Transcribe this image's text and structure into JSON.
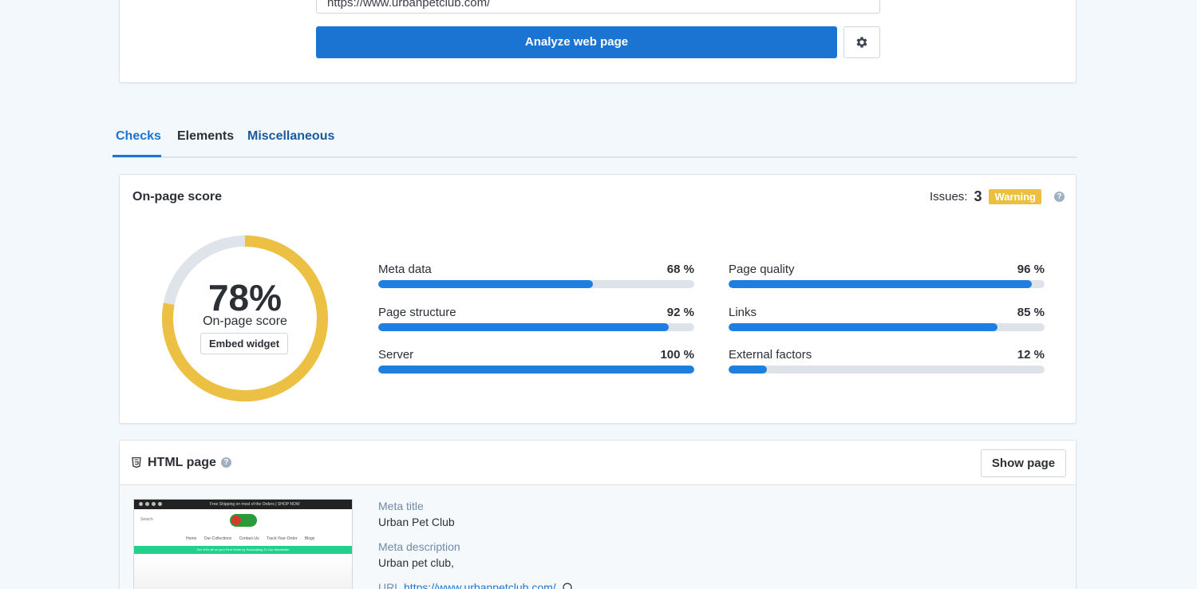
{
  "top": {
    "url_value": "https://www.urbanpetclub.com/",
    "analyze_label": "Analyze web page"
  },
  "tabs": [
    {
      "label": "Checks",
      "active": true
    },
    {
      "label": "Elements",
      "active": false
    },
    {
      "label": "Miscellaneous",
      "active": false
    }
  ],
  "score_card": {
    "title": "On-page score",
    "issues_label": "Issues:",
    "issues_count": "3",
    "issues_badge": "Warning",
    "score": 78,
    "score_text": "78%",
    "score_label": "On-page score",
    "embed_label": "Embed widget",
    "metrics": [
      {
        "name": "Meta data",
        "value": 68,
        "value_text": "68 %"
      },
      {
        "name": "Page quality",
        "value": 96,
        "value_text": "96 %"
      },
      {
        "name": "Page structure",
        "value": 92,
        "value_text": "92 %"
      },
      {
        "name": "Links",
        "value": 85,
        "value_text": "85 %"
      },
      {
        "name": "Server",
        "value": 100,
        "value_text": "100 %"
      },
      {
        "name": "External factors",
        "value": 12,
        "value_text": "12 %"
      }
    ]
  },
  "html_page": {
    "title": "HTML page",
    "show_page_label": "Show page",
    "meta_title_label": "Meta title",
    "meta_title_value": "Urban Pet Club",
    "meta_description_label": "Meta description",
    "meta_description_value": "Urban pet club,",
    "url_label": "URL",
    "url_value": "https://www.urbanpetclub.com/",
    "thumbnail": {
      "topbar_text": "Free Shipping on most of the Orders | SHOP NOW",
      "search_text": "Search",
      "nav_text": "Home Our-Collections Contact-Us Track-Your-Order Blogs",
      "banner_text": "Get 10% off on your First Order by Subscribing To Our Newsletter"
    }
  },
  "colors": {
    "accent": "#1b74d2",
    "bar_fill": "#1e7fe0",
    "bar_track": "#dee3ea",
    "donut_score": "#ebc043",
    "donut_track": "#dfe4ea",
    "warning": "#ecc03e"
  },
  "icons": {
    "settings": "gear-icon",
    "help": "question-circle-icon",
    "html": "html5-shield-icon",
    "external_link": "external-link-icon"
  }
}
